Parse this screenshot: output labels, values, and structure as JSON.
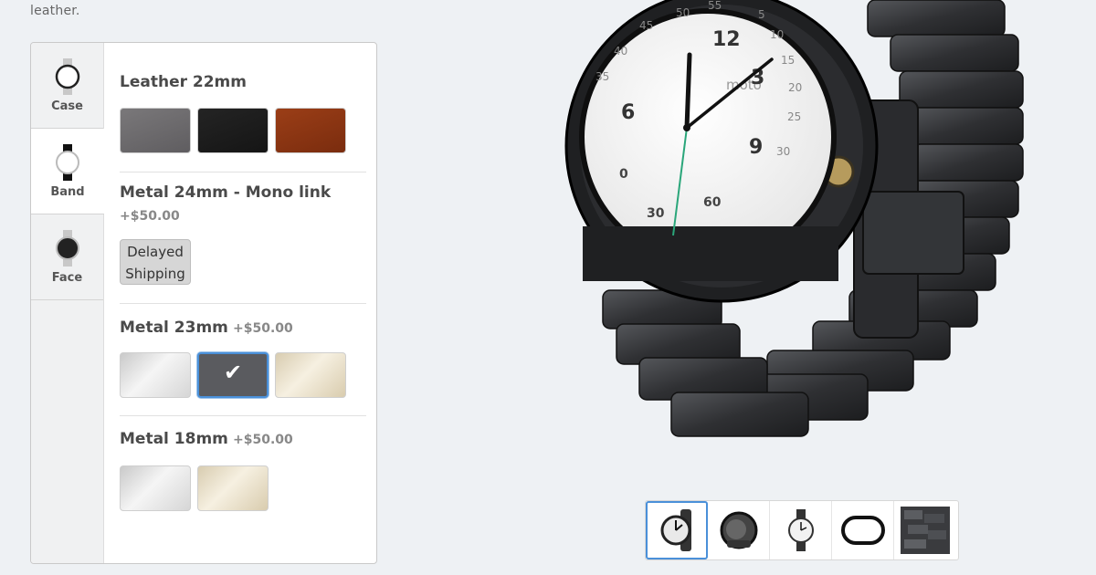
{
  "intro": {
    "text_tail": "leather."
  },
  "tabs": [
    {
      "label": "Case",
      "icon": "case-icon"
    },
    {
      "label": "Band",
      "icon": "band-icon"
    },
    {
      "label": "Face",
      "icon": "face-icon"
    }
  ],
  "active_tab": "Band",
  "band_options": [
    {
      "title": "Leather 22mm",
      "price": "",
      "swatches": [
        "gray",
        "black",
        "brown"
      ]
    },
    {
      "title": "Metal 24mm - Mono link",
      "price": "+$50.00",
      "status": "Delayed Shipping"
    },
    {
      "title": "Metal 23mm",
      "price": "+$50.00",
      "swatches": [
        "silver",
        "dark-gray",
        "gold"
      ],
      "selected": "dark-gray"
    },
    {
      "title": "Metal 18mm",
      "price": "+$50.00",
      "swatches": [
        "silver",
        "gold"
      ]
    }
  ],
  "watch_face": {
    "brand": "moto",
    "inner_numbers": [
      "12",
      "3",
      "6",
      "9"
    ],
    "outer_numbers": [
      "5",
      "10",
      "15",
      "20",
      "25",
      "30",
      "35",
      "40",
      "45",
      "50",
      "55"
    ],
    "bottom_numbers": [
      "0",
      "30",
      "60"
    ]
  },
  "thumbnails": [
    {
      "label": "front-view",
      "active": true
    },
    {
      "label": "angle-view"
    },
    {
      "label": "side-view"
    },
    {
      "label": "back-view"
    },
    {
      "label": "band-closeup"
    }
  ],
  "colors": {
    "accent": "#4a90d9",
    "swatch_selected": "#5a5b5f"
  }
}
